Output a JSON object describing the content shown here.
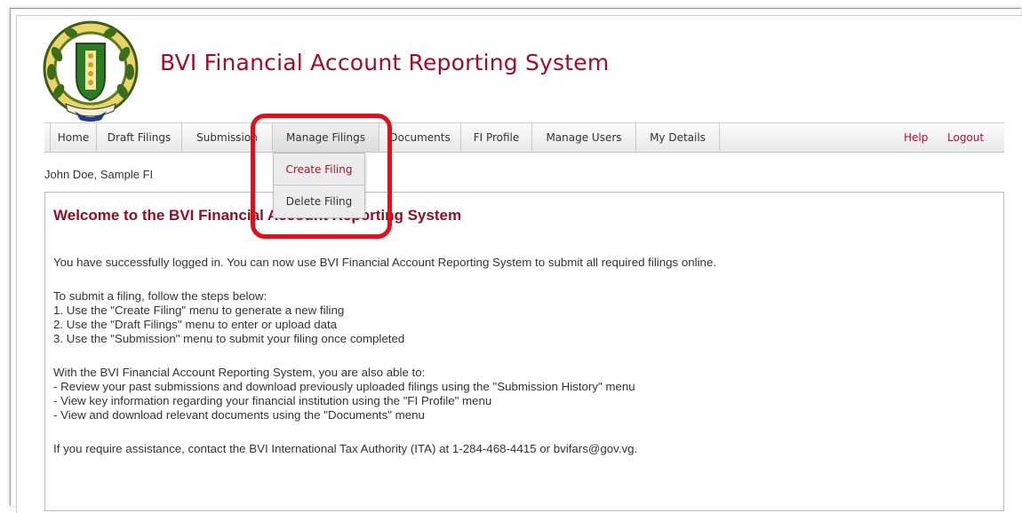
{
  "app": {
    "title": "BVI Financial Account Reporting System"
  },
  "nav": {
    "items": [
      {
        "label": "Home"
      },
      {
        "label": "Draft Filings"
      },
      {
        "label": "Submission"
      },
      {
        "label": "Manage Filings"
      },
      {
        "label": "Documents"
      },
      {
        "label": "FI Profile"
      },
      {
        "label": "Manage Users"
      },
      {
        "label": "My Details"
      }
    ],
    "help": "Help",
    "logout": "Logout"
  },
  "dropdown": {
    "create": "Create Filing",
    "delete": "Delete Filing"
  },
  "user": {
    "line": "John Doe, Sample FI"
  },
  "content": {
    "heading": "Welcome to the BVI Financial Account Reporting System",
    "intro": "You have successfully logged in. You can now use BVI Financial Account Reporting System to submit all required filings online.",
    "steps_heading": "To submit a filing, follow the steps below:",
    "steps": [
      "1. Use the \"Create Filing\" menu to generate a new filing",
      "2. Use the \"Draft Filings\" menu to enter or upload data",
      "3. Use the \"Submission\" menu to submit your filing once completed"
    ],
    "also_heading": "With the BVI Financial Account Reporting System, you are also able to:",
    "also": [
      "- Review your past submissions and download previously uploaded filings using the \"Submission History\" menu",
      "- View key information regarding your financial institution using the \"FI Profile\" menu",
      "- View and download relevant documents using the \"Documents\" menu"
    ],
    "assistance": "If you require assistance, contact the BVI International Tax Authority (ITA) at 1-284-468-4415 or bvifars@gov.vg."
  },
  "colors": {
    "brand": "#a40c26",
    "highlight": "#e0101a",
    "link": "#b0132b"
  }
}
